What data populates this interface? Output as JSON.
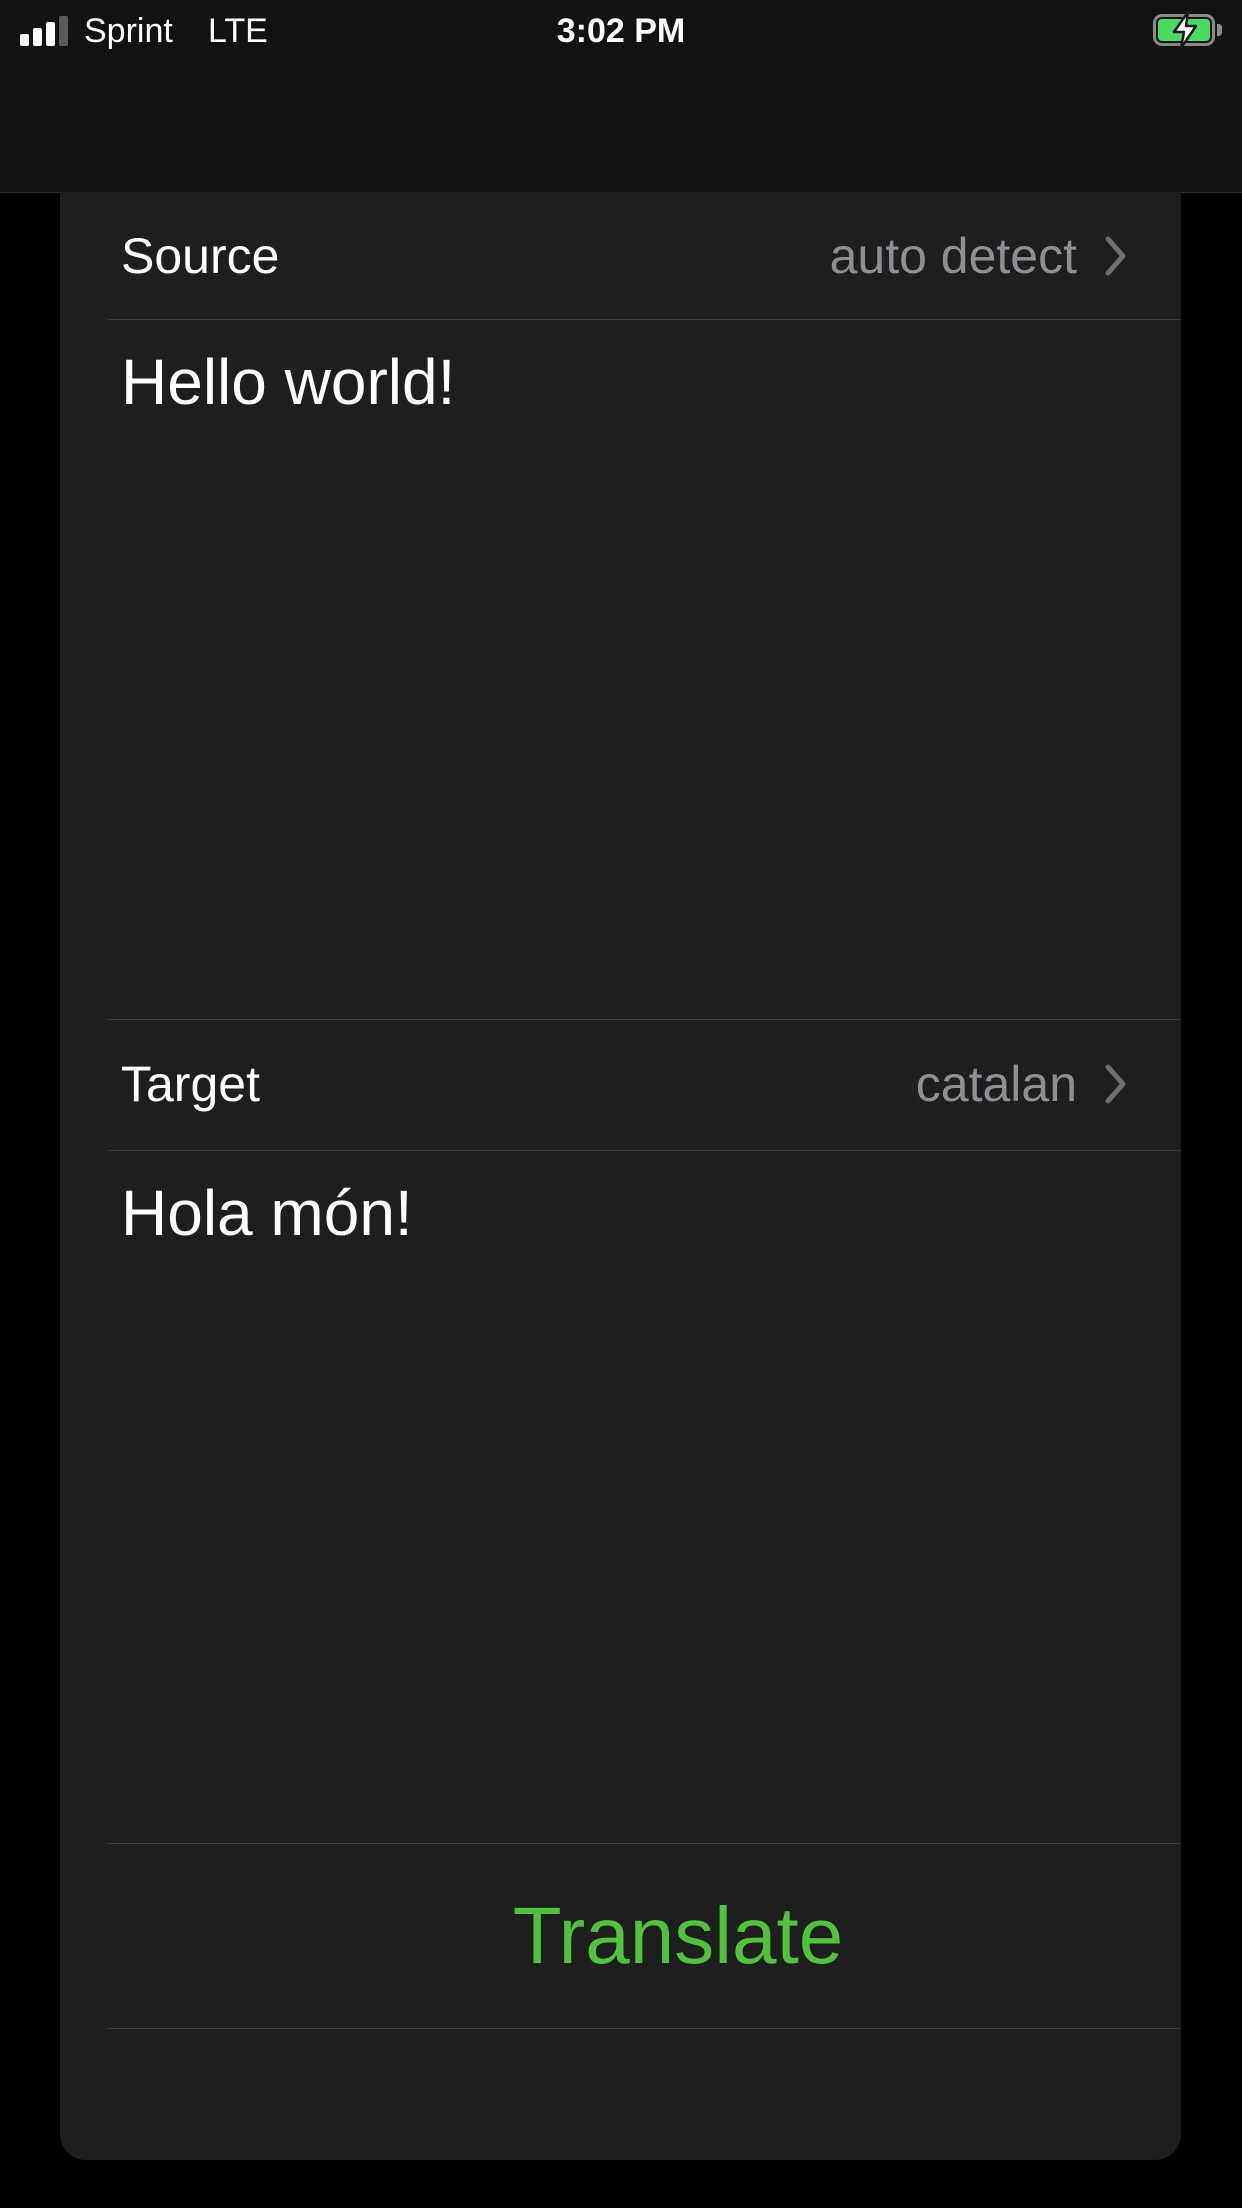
{
  "status_bar": {
    "carrier": "Sprint",
    "network": "LTE",
    "time": "3:02 PM",
    "signal_bars_active": 3,
    "signal_bars_total": 4,
    "battery_charging": true,
    "battery_color": "#4cd964"
  },
  "source": {
    "label": "Source",
    "language": "auto detect",
    "text": "Hello world!"
  },
  "target": {
    "label": "Target",
    "language": "catalan",
    "text": "Hola món!"
  },
  "actions": {
    "translate_label": "Translate",
    "translate_color": "#52c13c"
  },
  "icons": {
    "row_disclosure": "chevron-right-icon",
    "battery": "battery-charging-icon",
    "signal": "cellular-signal-icon"
  }
}
